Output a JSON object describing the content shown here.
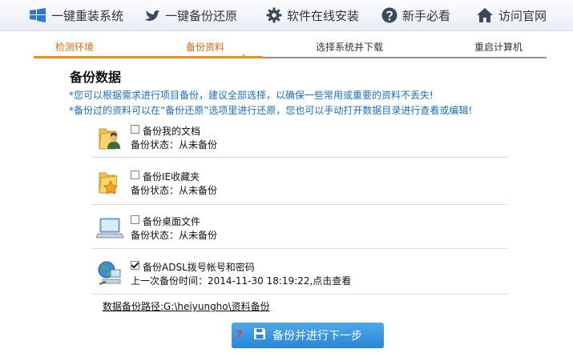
{
  "nav": {
    "items": [
      {
        "label": "一键重装系统",
        "icon": "windows-logo-icon"
      },
      {
        "label": "一键备份还原",
        "icon": "bird-icon"
      },
      {
        "label": "软件在线安装",
        "icon": "gear-icon"
      },
      {
        "label": "新手必看",
        "icon": "question-icon"
      },
      {
        "label": "访问官网",
        "icon": "home-icon"
      }
    ]
  },
  "steps": [
    "检测环境",
    "备份资料",
    "选择系统并下载",
    "重启计算机"
  ],
  "section": {
    "title": "备份数据",
    "note1": "*您可以根据需求进行项目备份，建议全部选择，以确保一些常用或重要的资料不丢失!",
    "note2": "*备份过的资料可以在“备份还原”选项里进行还原，您也可以手动打开数据目录进行查看或编辑!"
  },
  "items": [
    {
      "label": "备份我的文档",
      "status": "备份状态：从未备份",
      "checked": false,
      "icon": "user-folder-icon"
    },
    {
      "label": "备份IE收藏夹",
      "status": "备份状态：从未备份",
      "checked": false,
      "icon": "favorites-folder-icon"
    },
    {
      "label": "备份桌面文件",
      "status": "备份状态：从未备份",
      "checked": false,
      "icon": "desktop-icon"
    },
    {
      "label": "备份ADSL拨号帐号和密码",
      "status": "上一次备份时间：2014-11-30 18:19:22,点击查看",
      "checked": true,
      "icon": "network-icon"
    }
  ],
  "path": "数据备份路径:G:\\heiyungho\\资料备份",
  "button": {
    "number": "7",
    "label": "备份并进行下一步",
    "icon": "save-icon"
  },
  "colors": {
    "accent": "#f08a1c",
    "blue": "#2a86d6",
    "note": "#1a6fc4"
  }
}
